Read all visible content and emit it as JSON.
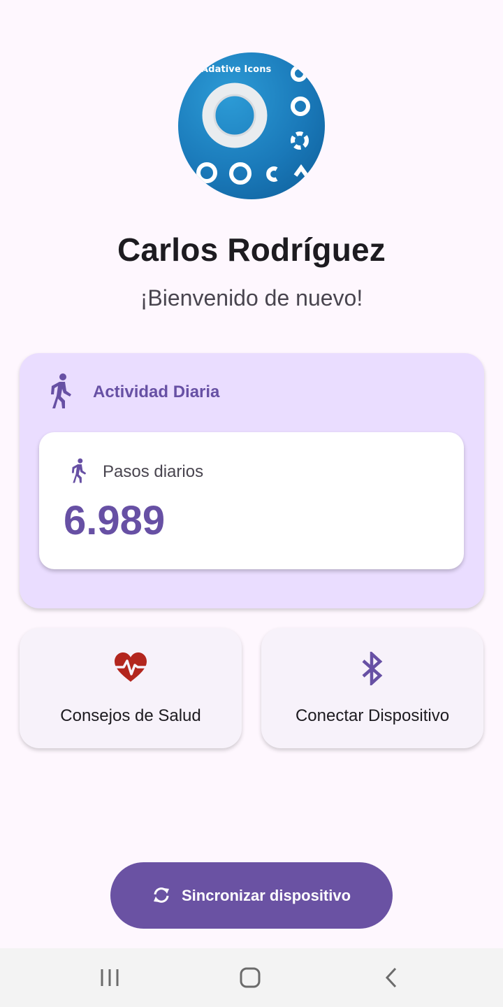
{
  "profile": {
    "avatar_caption": "Adative Icons",
    "name": "Carlos Rodríguez",
    "welcome": "¡Bienvenido de nuevo!"
  },
  "activity": {
    "title": "Actividad Diaria",
    "icon": "walking-person-icon",
    "steps_label": "Pasos diarios",
    "steps_value": "6.989"
  },
  "actions": {
    "health_label": "Consejos de Salud",
    "health_icon": "heart-pulse-icon",
    "connect_label": "Conectar Dispositivo",
    "connect_icon": "bluetooth-icon"
  },
  "sync": {
    "label": "Sincronizar dispositivo",
    "icon": "sync-icon"
  },
  "colors": {
    "primary": "#6750A4",
    "card_background": "#EADDFF",
    "heart": "#B3261E",
    "page_background": "#FEF7FE"
  }
}
